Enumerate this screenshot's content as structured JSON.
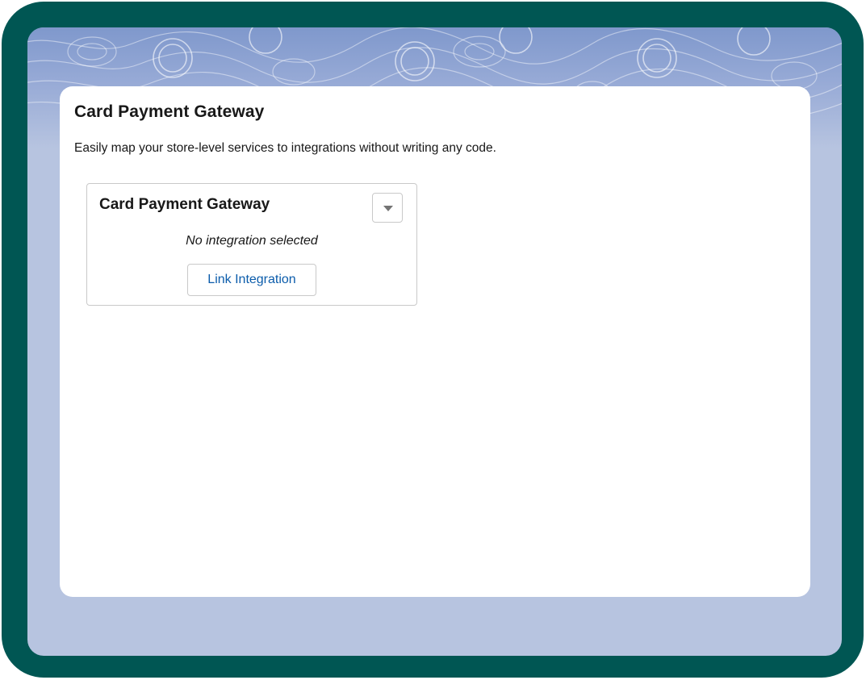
{
  "page": {
    "title": "Card Payment Gateway",
    "description": "Easily map your store-level services to integrations without writing any code."
  },
  "gateway_card": {
    "title": "Card Payment Gateway",
    "menu_icon": "chevron-down-icon",
    "status_text": "No integration selected",
    "link_button_label": "Link Integration"
  },
  "colors": {
    "frame": "#005653",
    "screen_background": "#b7c4e0",
    "banner_blue": "#7f98cc",
    "link_blue": "#0b5cab",
    "border": "#c9c9c9",
    "text": "#181818"
  }
}
